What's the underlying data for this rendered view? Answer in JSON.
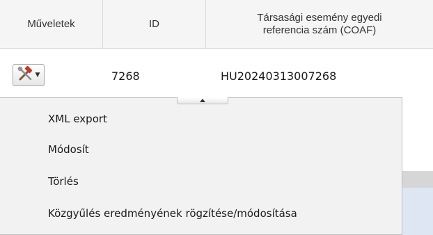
{
  "table": {
    "headers": {
      "actions": "Műveletek",
      "id": "ID",
      "coaf_line1": "Társasági esemény egyedi",
      "coaf_line2": "referencia szám (COAF)"
    },
    "row": {
      "id": "7268",
      "coaf": "HU20240313007268"
    }
  },
  "actions_button": {
    "icon": "tools-icon",
    "caret": "▼"
  },
  "dropdown": {
    "items": [
      {
        "label": "XML export"
      },
      {
        "label": "Módosít"
      },
      {
        "label": "Törlés"
      },
      {
        "label": "Közgyűlés eredményének rögzítése/módosítása"
      }
    ]
  },
  "colors": {
    "menu_bg": "#f2f2f2",
    "header_bg": "#f5f5f5",
    "highlight_blue": "#dde6f2"
  }
}
